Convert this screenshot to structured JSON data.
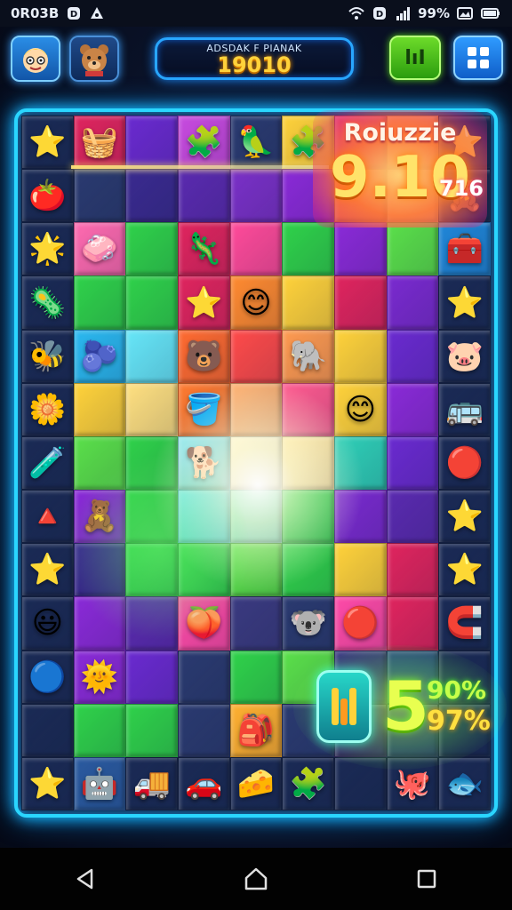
{
  "status_bar": {
    "time": "0R03B",
    "battery": "99%"
  },
  "header": {
    "score_label": "ADSDAK F PIANAK",
    "score_value": "19010",
    "pause_label": "lıI"
  },
  "puzzle_badge": {
    "title": "Roiuzzie",
    "score": "9.10",
    "suffix": "716"
  },
  "bonus_badge": {
    "number": "5",
    "percent_top": "90%",
    "percent_bottom": "97%"
  },
  "colors": {
    "board_border": "#2ad6ff",
    "score_text": "#ffd23a",
    "pause_button": "#3fc01a",
    "menu_button": "#1f7ee8"
  },
  "board": {
    "rows": [
      [
        {
          "c": "#1a2a55",
          "toy": "⭐",
          "col": "#2fd24a"
        },
        {
          "c": "#e0245e",
          "toy": "🧺"
        },
        {
          "c": "#6a2ad0",
          "toy": ""
        },
        {
          "c": "#c84ae0",
          "toy": "🧩"
        },
        {
          "c": "#2a3a70",
          "toy": "🦜"
        },
        {
          "c": "#ffd23a",
          "toy": "🧩"
        },
        {
          "c": "#e84a6a",
          "toy": ""
        },
        {
          "c": "#ff9a50",
          "toy": ""
        },
        {
          "c": "#1a2a55",
          "toy": "⭐",
          "col": "#4ab8ff"
        }
      ],
      [
        {
          "c": "#1a2a55",
          "toy": "🍅"
        },
        {
          "c": "#2a3a70",
          "toy": ""
        },
        {
          "c": "#3a2a90",
          "toy": ""
        },
        {
          "c": "#5a2ab0",
          "toy": ""
        },
        {
          "c": "#7a30c8",
          "toy": ""
        },
        {
          "c": "#8a2ad8",
          "toy": ""
        },
        {
          "c": "#ff7a40",
          "toy": ""
        },
        {
          "c": "#ffb060",
          "toy": ""
        },
        {
          "c": "#1a2a55",
          "toy": "🧸"
        }
      ],
      [
        {
          "c": "#1a2a55",
          "toy": "🌟"
        },
        {
          "c": "#ff6ab0",
          "toy": "🧼"
        },
        {
          "c": "#2fd24a",
          "toy": ""
        },
        {
          "c": "#e0245e",
          "toy": "🦎"
        },
        {
          "c": "#ff4a9a",
          "toy": ""
        },
        {
          "c": "#2fd24a",
          "toy": ""
        },
        {
          "c": "#8a2ad8",
          "toy": ""
        },
        {
          "c": "#5ae04a",
          "toy": ""
        },
        {
          "c": "#1f86d8",
          "toy": "🧰"
        }
      ],
      [
        {
          "c": "#1a2a55",
          "toy": "🦠"
        },
        {
          "c": "#2fd24a",
          "toy": ""
        },
        {
          "c": "#2fd24a",
          "toy": ""
        },
        {
          "c": "#e0245e",
          "toy": "⭐"
        },
        {
          "c": "#ff8a30",
          "toy": "😊"
        },
        {
          "c": "#ffd23a",
          "toy": ""
        },
        {
          "c": "#e0245e",
          "toy": ""
        },
        {
          "c": "#7a2ad0",
          "toy": ""
        },
        {
          "c": "#1a2a55",
          "toy": "⭐",
          "col": "#ff4a8a"
        }
      ],
      [
        {
          "c": "#1a2a55",
          "toy": "🐝"
        },
        {
          "c": "#2ab8f0",
          "toy": "🫐"
        },
        {
          "c": "#66e6f8",
          "toy": ""
        },
        {
          "c": "#ff6a30",
          "toy": "🐻"
        },
        {
          "c": "#ff4a4a",
          "toy": ""
        },
        {
          "c": "#ff9a50",
          "toy": "🐘"
        },
        {
          "c": "#ffd23a",
          "toy": ""
        },
        {
          "c": "#6a2ad0",
          "toy": ""
        },
        {
          "c": "#1a2a55",
          "toy": "🐷"
        }
      ],
      [
        {
          "c": "#1a2a55",
          "toy": "🌼"
        },
        {
          "c": "#ffd23a",
          "toy": ""
        },
        {
          "c": "#ffe080",
          "toy": ""
        },
        {
          "c": "#ff7a30",
          "toy": "🪣"
        },
        {
          "c": "#ffb070",
          "toy": ""
        },
        {
          "c": "#ff5a90",
          "toy": ""
        },
        {
          "c": "#ffd23a",
          "toy": "😊"
        },
        {
          "c": "#8a2ad8",
          "toy": ""
        },
        {
          "c": "#1a2a55",
          "toy": "🚌"
        }
      ],
      [
        {
          "c": "#1a2a55",
          "toy": "🧪"
        },
        {
          "c": "#5ae04a",
          "toy": ""
        },
        {
          "c": "#2fd24a",
          "toy": ""
        },
        {
          "c": "#8ae8f0",
          "toy": "🐕"
        },
        {
          "c": "#fff4d0",
          "toy": ""
        },
        {
          "c": "#ffe6a0",
          "toy": ""
        },
        {
          "c": "#2fd0b8",
          "toy": ""
        },
        {
          "c": "#6a2ad0",
          "toy": ""
        },
        {
          "c": "#1a2a55",
          "toy": "🔴"
        }
      ],
      [
        {
          "c": "#1a2a55",
          "toy": "🔺"
        },
        {
          "c": "#8a2ad8",
          "toy": "🧸"
        },
        {
          "c": "#2fd24a",
          "toy": ""
        },
        {
          "c": "#66e6f8",
          "toy": ""
        },
        {
          "c": "#8ae8c8",
          "toy": ""
        },
        {
          "c": "#2fd24a",
          "toy": ""
        },
        {
          "c": "#7a2ad0",
          "toy": ""
        },
        {
          "c": "#5a2ab0",
          "toy": ""
        },
        {
          "c": "#1a2a55",
          "toy": "⭐",
          "col": "#b070ff"
        }
      ],
      [
        {
          "c": "#1a2a55",
          "toy": "⭐",
          "col": "#d04ad8"
        },
        {
          "c": "#3a2a90",
          "toy": ""
        },
        {
          "c": "#2fd24a",
          "toy": ""
        },
        {
          "c": "#2fd24a",
          "toy": ""
        },
        {
          "c": "#5ae04a",
          "toy": ""
        },
        {
          "c": "#2fd24a",
          "toy": ""
        },
        {
          "c": "#ffd23a",
          "toy": ""
        },
        {
          "c": "#e0245e",
          "toy": ""
        },
        {
          "c": "#1a2a55",
          "toy": "⭐",
          "col": "#2fd24a"
        }
      ],
      [
        {
          "c": "#1a2a55",
          "toy": "😃"
        },
        {
          "c": "#8a2ad8",
          "toy": ""
        },
        {
          "c": "#5a2ab0",
          "toy": ""
        },
        {
          "c": "#ff4aa8",
          "toy": "🍑"
        },
        {
          "c": "#3a3a80",
          "toy": ""
        },
        {
          "c": "#2a3a70",
          "toy": "🐨"
        },
        {
          "c": "#ff4aa8",
          "toy": "🔴"
        },
        {
          "c": "#e0245e",
          "toy": ""
        },
        {
          "c": "#1a2a55",
          "toy": "🧲"
        }
      ],
      [
        {
          "c": "#1a2a55",
          "toy": "🔵"
        },
        {
          "c": "#8a2ad8",
          "toy": "🌞"
        },
        {
          "c": "#6a2ad0",
          "toy": ""
        },
        {
          "c": "#2a3a70",
          "toy": ""
        },
        {
          "c": "#2fd24a",
          "toy": ""
        },
        {
          "c": "#5ae04a",
          "toy": ""
        },
        {
          "c": "#3a3a80",
          "toy": ""
        },
        {
          "c": "#2a4a80",
          "toy": ""
        },
        {
          "c": "#1a2a55",
          "toy": ""
        }
      ],
      [
        {
          "c": "#1a2a55",
          "toy": ""
        },
        {
          "c": "#2fd24a",
          "toy": ""
        },
        {
          "c": "#2fd24a",
          "toy": ""
        },
        {
          "c": "#2a3a70",
          "toy": ""
        },
        {
          "c": "#ffb030",
          "toy": "🎒"
        },
        {
          "c": "#2a3a70",
          "toy": ""
        },
        {
          "c": "#3a2a70",
          "toy": ""
        },
        {
          "c": "#2a3a70",
          "toy": ""
        },
        {
          "c": "#1a2a55",
          "toy": ""
        }
      ],
      [
        {
          "c": "#1a2a55",
          "toy": "⭐",
          "col": "#4ab8ff"
        },
        {
          "c": "#2a5aa0",
          "toy": "🤖"
        },
        {
          "c": "#1a2a55",
          "toy": "🚚"
        },
        {
          "c": "#1a2a55",
          "toy": "🚗"
        },
        {
          "c": "#1a2a55",
          "toy": "🧀"
        },
        {
          "c": "#1a2a55",
          "toy": "🧩"
        },
        {
          "c": "#1a2a55",
          "toy": ""
        },
        {
          "c": "#1a2a55",
          "toy": "🐙"
        },
        {
          "c": "#1a2a55",
          "toy": "🐟"
        }
      ]
    ]
  }
}
